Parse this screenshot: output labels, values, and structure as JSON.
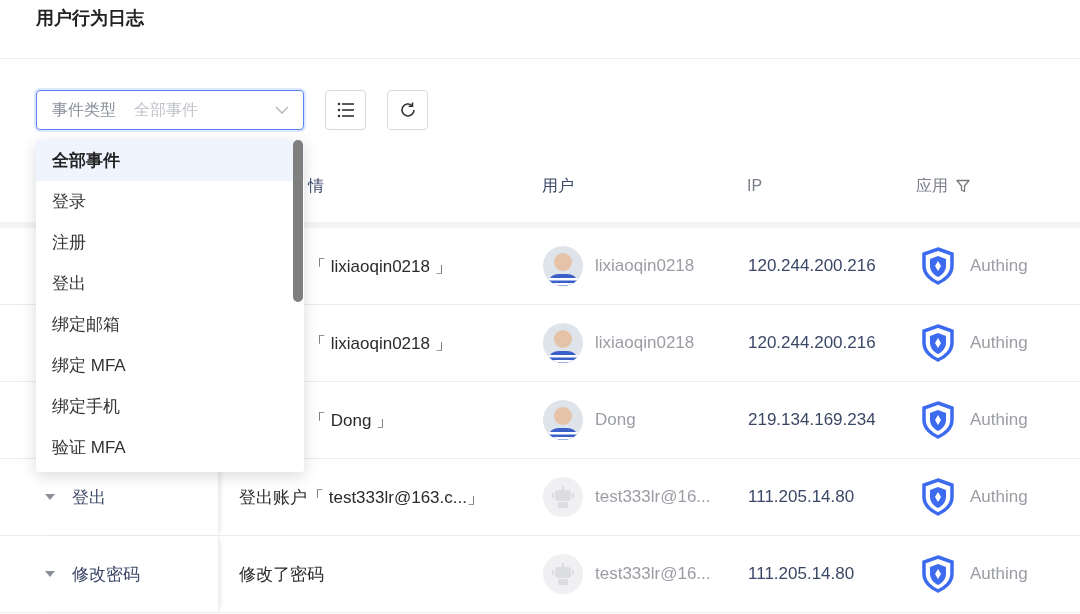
{
  "page": {
    "title": "用户行为日志"
  },
  "filter": {
    "label": "事件类型",
    "value": "全部事件",
    "focused": true,
    "open": true,
    "options": [
      {
        "label": "全部事件",
        "selected": true
      },
      {
        "label": "登录",
        "selected": false
      },
      {
        "label": "注册",
        "selected": false
      },
      {
        "label": "登出",
        "selected": false
      },
      {
        "label": "绑定邮箱",
        "selected": false
      },
      {
        "label": "绑定 MFA",
        "selected": false
      },
      {
        "label": "绑定手机",
        "selected": false
      },
      {
        "label": "验证 MFA",
        "selected": false
      }
    ]
  },
  "toolbar_buttons": [
    {
      "kind": "list"
    },
    {
      "kind": "refresh"
    }
  ],
  "table": {
    "columns": [
      {
        "kind": "details",
        "label": "情"
      },
      {
        "kind": "user",
        "label": "用户"
      },
      {
        "kind": "ip",
        "label": "IP"
      },
      {
        "kind": "app",
        "label": "应用",
        "filter": true
      }
    ],
    "rows": [
      {
        "details": "「 lixiaoqin0218 」",
        "user": "lixiaoqin0218",
        "ip": "120.244.200.216",
        "app": "Authing"
      },
      {
        "details": "「 lixiaoqin0218 」",
        "user": "lixiaoqin0218",
        "ip": "120.244.200.216",
        "app": "Authing"
      },
      {
        "details": "「 Dong 」",
        "user": "Dong",
        "ip": "219.134.169.234",
        "app": "Authing"
      },
      {
        "event": "登出",
        "details": "登出账户「 test333lr@163.c...」",
        "user": "test333lr@16...",
        "avatar": {
          "kind": "robot"
        },
        "ip": "111.205.14.80",
        "app": "Authing"
      },
      {
        "event": "修改密码",
        "details": "修改了密码",
        "user": "test333lr@16...",
        "avatar": {
          "kind": "robot"
        },
        "ip": "111.205.14.80",
        "app": "Authing"
      }
    ]
  }
}
